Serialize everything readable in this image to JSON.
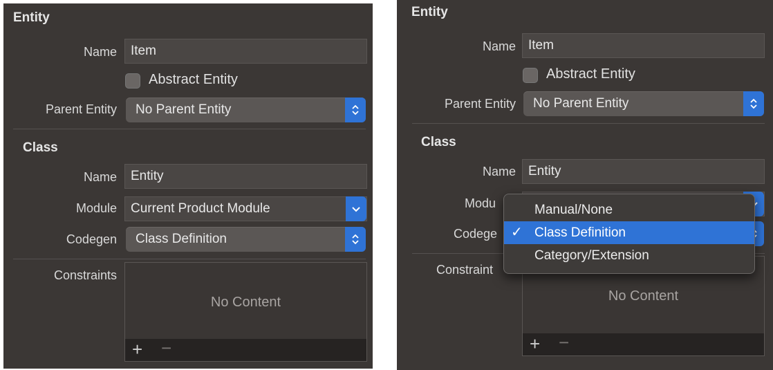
{
  "entity": {
    "section_title": "Entity",
    "name_label": "Name",
    "name_value": "Item",
    "abstract_label": "Abstract Entity",
    "parent_label": "Parent Entity",
    "parent_value": "No Parent Entity"
  },
  "class": {
    "section_title": "Class",
    "name_label": "Name",
    "name_value": "Entity",
    "module_label": "Module",
    "module_value": "Current Product Module",
    "codegen_label": "Codegen",
    "codegen_value": "Class Definition"
  },
  "constraints": {
    "label": "Constraints",
    "empty_text": "No Content",
    "add_symbol": "+",
    "remove_symbol": "−"
  },
  "right_panel": {
    "module_label_clipped": "Modu",
    "codegen_label_clipped": "Codege",
    "constraints_label_clipped": "Constraint"
  },
  "codegen_menu": {
    "options": [
      "Manual/None",
      "Class Definition",
      "Category/Extension"
    ],
    "selected_index": 1,
    "check_symbol": "✓"
  },
  "icons": {
    "stepper": "up-down-chevron-icon",
    "dropdown": "chevron-down-icon",
    "add": "plus-icon",
    "remove": "minus-icon"
  },
  "colors": {
    "panel_bg": "#3b3735",
    "accent": "#2f73d6"
  }
}
